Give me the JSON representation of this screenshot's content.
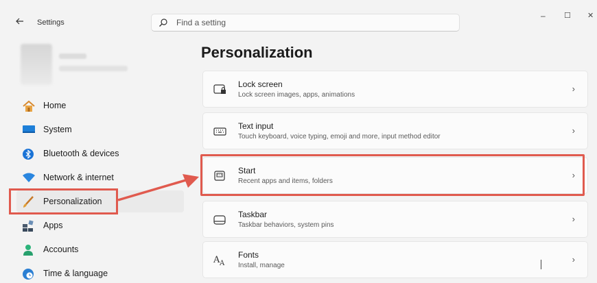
{
  "titlebar": {
    "back_icon": "arrow-left-icon",
    "app_title": "Settings",
    "minimize_glyph": "–",
    "maximize_glyph": "☐",
    "close_glyph": "✕"
  },
  "search": {
    "placeholder": "Find a setting",
    "icon": "search-icon"
  },
  "sidebar": {
    "items": [
      {
        "label": "Home",
        "icon": "home-icon"
      },
      {
        "label": "System",
        "icon": "monitor-icon"
      },
      {
        "label": "Bluetooth & devices",
        "icon": "bluetooth-icon"
      },
      {
        "label": "Network & internet",
        "icon": "wifi-icon"
      },
      {
        "label": "Personalization",
        "icon": "paintbrush-icon",
        "selected": true
      },
      {
        "label": "Apps",
        "icon": "apps-icon"
      },
      {
        "label": "Accounts",
        "icon": "person-icon"
      },
      {
        "label": "Time & language",
        "icon": "globe-clock-icon"
      }
    ]
  },
  "main": {
    "title": "Personalization",
    "cards": [
      {
        "title": "Lock screen",
        "subtitle": "Lock screen images, apps, animations",
        "icon": "lock-screen-icon"
      },
      {
        "title": "Text input",
        "subtitle": "Touch keyboard, voice typing, emoji and more, input method editor",
        "icon": "keyboard-icon"
      },
      {
        "title": "Start",
        "subtitle": "Recent apps and items, folders",
        "icon": "start-menu-icon",
        "highlighted": true
      },
      {
        "title": "Taskbar",
        "subtitle": "Taskbar behaviors, system pins",
        "icon": "taskbar-icon"
      },
      {
        "title": "Fonts",
        "subtitle": "Install, manage",
        "icon": "fonts-icon"
      }
    ],
    "chevron_glyph": "›"
  },
  "annotation": {
    "highlight_color": "#e05a4e"
  },
  "colors": {
    "accent": "#005fb8",
    "window_bg": "#f3f3f3",
    "card_bg": "#fbfbfb"
  }
}
